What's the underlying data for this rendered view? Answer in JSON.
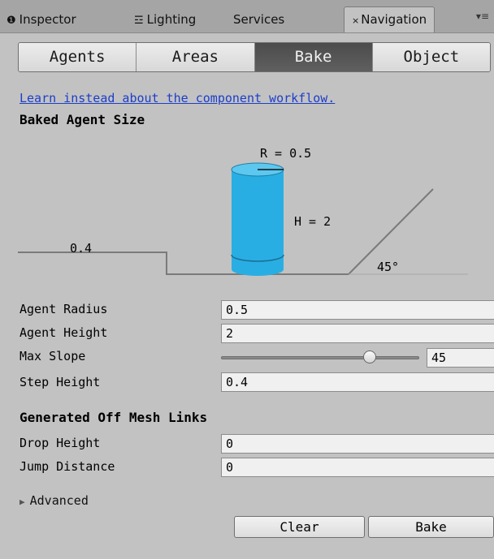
{
  "window_tabs": [
    {
      "label": "Inspector",
      "icon": "info-icon"
    },
    {
      "label": "Lighting",
      "icon": "lighting-icon"
    },
    {
      "label": "Services",
      "icon": ""
    },
    {
      "label": "Navigation",
      "icon": "close-icon",
      "active": true
    }
  ],
  "segments": [
    "Agents",
    "Areas",
    "Bake",
    "Object"
  ],
  "selected_segment": "Bake",
  "learn_link": "Learn instead about the component workflow.",
  "baked_agent_size": {
    "title": "Baked Agent Size",
    "radius_label": "R = 0.5",
    "height_label": "H = 2",
    "step_label": "0.4",
    "slope_label": "45°",
    "colors": {
      "agent": "#29aee3",
      "agent_top": "#5cc8f0",
      "ground": "#7a7a7a"
    }
  },
  "fields": {
    "agent_radius": {
      "label": "Agent Radius",
      "value": "0.5"
    },
    "agent_height": {
      "label": "Agent Height",
      "value": "2"
    },
    "max_slope": {
      "label": "Max Slope",
      "value": "45",
      "min": 0,
      "max": 60
    },
    "step_height": {
      "label": "Step Height",
      "value": "0.4"
    }
  },
  "offmesh": {
    "title": "Generated Off Mesh Links",
    "drop_height": {
      "label": "Drop Height",
      "value": "0"
    },
    "jump_distance": {
      "label": "Jump Distance",
      "value": "0"
    }
  },
  "advanced_label": "Advanced",
  "buttons": {
    "clear": "Clear",
    "bake": "Bake"
  }
}
